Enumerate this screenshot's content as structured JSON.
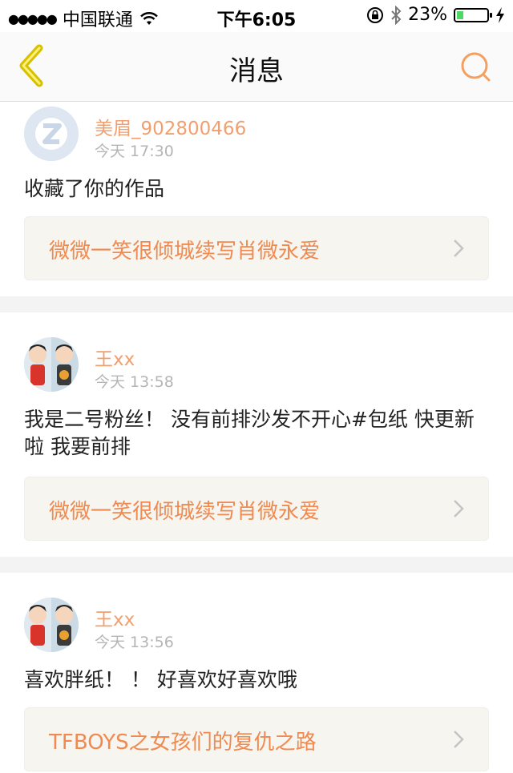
{
  "status_bar": {
    "carrier": "中国联通",
    "time": "下午6:05",
    "battery": "23%",
    "battery_level": 0.23
  },
  "nav": {
    "title": "消息",
    "back_icon": "chevron-left-icon",
    "search_icon": "search-icon"
  },
  "messages": [
    {
      "user": "美眉_902800466",
      "time": "今天 17:30",
      "text": "收藏了你的作品",
      "link": "微微一笑很倾城续写肖微永爱",
      "avatar": "qq-default-avatar"
    },
    {
      "user": "王xx",
      "time": "今天 13:58",
      "text": "我是二号粉丝！  没有前排沙发不开心#包纸 快更新啦 我要前排",
      "link": "微微一笑很倾城续写肖微永爱",
      "avatar": "cartoon-couple-avatar"
    },
    {
      "user": "王xx",
      "time": "今天 13:56",
      "text": "喜欢胖纸！ ！ 好喜欢好喜欢哦",
      "link": "TFBOYS之女孩们的复仇之路",
      "avatar": "cartoon-couple-avatar"
    }
  ],
  "colors": {
    "accent": "#f08a50",
    "username": "#f0a070",
    "card_bg": "#f6f5f0"
  }
}
